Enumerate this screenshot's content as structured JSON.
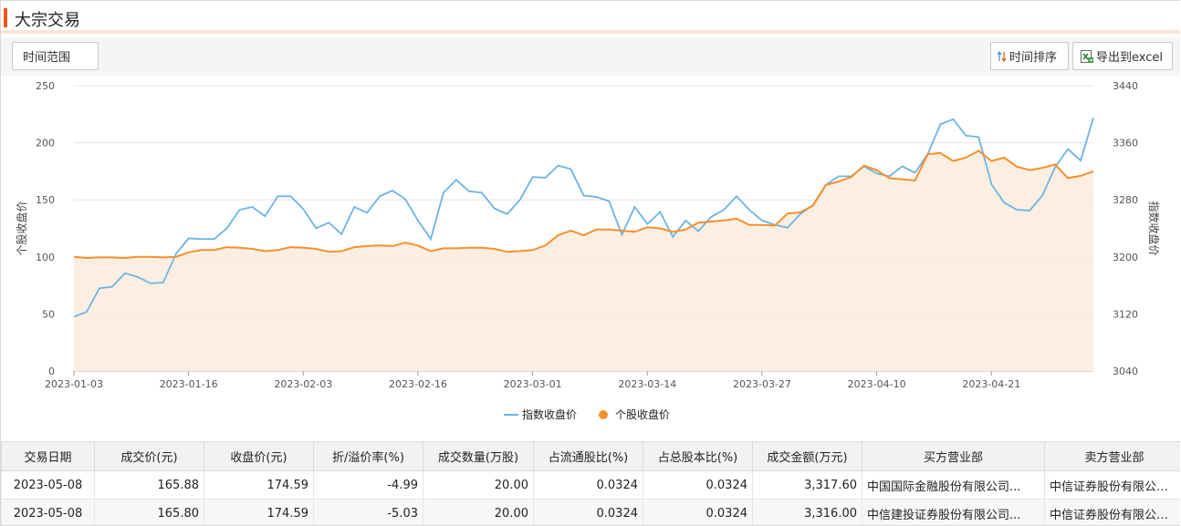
{
  "page": {
    "title": "大宗交易"
  },
  "toolbar": {
    "range_label": "时间范围",
    "sort_label": "时间排序",
    "export_label": "导出到excel"
  },
  "colors": {
    "accent": "#e8591c",
    "index_line": "#6cb4e4",
    "stock_line": "#f7902c",
    "stock_area": "#fdeee2"
  },
  "chart_data": {
    "type": "line",
    "x": [
      "2023-01-03",
      "2023-01-04",
      "2023-01-05",
      "2023-01-06",
      "2023-01-09",
      "2023-01-10",
      "2023-01-11",
      "2023-01-12",
      "2023-01-13",
      "2023-01-16",
      "2023-01-17",
      "2023-01-18",
      "2023-01-19",
      "2023-01-20",
      "2023-01-30",
      "2023-01-31",
      "2023-02-01",
      "2023-02-02",
      "2023-02-03",
      "2023-02-06",
      "2023-02-07",
      "2023-02-08",
      "2023-02-09",
      "2023-02-10",
      "2023-02-13",
      "2023-02-14",
      "2023-02-15",
      "2023-02-16",
      "2023-02-17",
      "2023-02-20",
      "2023-02-21",
      "2023-02-22",
      "2023-02-23",
      "2023-02-24",
      "2023-02-27",
      "2023-02-28",
      "2023-03-01",
      "2023-03-02",
      "2023-03-03",
      "2023-03-06",
      "2023-03-07",
      "2023-03-08",
      "2023-03-09",
      "2023-03-10",
      "2023-03-13",
      "2023-03-14",
      "2023-03-15",
      "2023-03-16",
      "2023-03-17",
      "2023-03-20",
      "2023-03-21",
      "2023-03-22",
      "2023-03-23",
      "2023-03-24",
      "2023-03-27",
      "2023-03-28",
      "2023-03-29",
      "2023-03-30",
      "2023-03-31",
      "2023-04-03",
      "2023-04-04",
      "2023-04-06",
      "2023-04-07",
      "2023-04-10",
      "2023-04-11",
      "2023-04-12",
      "2023-04-13",
      "2023-04-14",
      "2023-04-17",
      "2023-04-18",
      "2023-04-19",
      "2023-04-20",
      "2023-04-21",
      "2023-04-24",
      "2023-04-25",
      "2023-04-26",
      "2023-04-27",
      "2023-04-28",
      "2023-05-04",
      "2023-05-05",
      "2023-05-08"
    ],
    "x_ticks": [
      "2023-01-03",
      "2023-01-16",
      "2023-02-03",
      "2023-02-16",
      "2023-03-01",
      "2023-03-14",
      "2023-03-27",
      "2023-04-10",
      "2023-04-21"
    ],
    "y_left": {
      "label": "个股收盘价",
      "lim": [
        0,
        250
      ],
      "ticks": [
        0,
        50,
        100,
        150,
        200,
        250
      ]
    },
    "y_right": {
      "label": "指数收盘价",
      "lim": [
        3040,
        3440
      ],
      "ticks": [
        3040,
        3120,
        3200,
        3280,
        3360,
        3440
      ]
    },
    "grid": true,
    "legend_position": "bottom",
    "series": [
      {
        "name": "指数收盘价",
        "axis": "right",
        "values": [
          3116,
          3123,
          3156,
          3158,
          3177,
          3172,
          3163,
          3164,
          3204,
          3226,
          3225,
          3225,
          3240,
          3266,
          3270,
          3257,
          3285,
          3285,
          3267,
          3240,
          3248,
          3232,
          3270,
          3262,
          3285,
          3293,
          3281,
          3251,
          3225,
          3290,
          3308,
          3292,
          3290,
          3268,
          3260,
          3280,
          3312,
          3311,
          3328,
          3323,
          3286,
          3284,
          3278,
          3231,
          3270,
          3246,
          3263,
          3228,
          3251,
          3236,
          3256,
          3266,
          3285,
          3266,
          3251,
          3245,
          3241,
          3260,
          3273,
          3301,
          3313,
          3313,
          3327,
          3317,
          3313,
          3327,
          3318,
          3344,
          3386,
          3393,
          3370,
          3368,
          3302,
          3276,
          3266,
          3265,
          3286,
          3326,
          3351,
          3335,
          3395
        ]
      },
      {
        "name": "个股收盘价",
        "axis": "left",
        "values": [
          100,
          99,
          99.5,
          99.5,
          99,
          100,
          100,
          99.5,
          100,
          104,
          106,
          106,
          108.5,
          108,
          107,
          105,
          106,
          108.5,
          108,
          107,
          104.5,
          105,
          108.5,
          109.5,
          110,
          109.5,
          112.5,
          110,
          105,
          107.5,
          107.5,
          108,
          108,
          107,
          104.5,
          105,
          106,
          110,
          119,
          123,
          119,
          124,
          124,
          123,
          122,
          126,
          125,
          122,
          124,
          130,
          131,
          132,
          133.5,
          128,
          128,
          127.5,
          138,
          139,
          145,
          163,
          166,
          170,
          180,
          176,
          169,
          168,
          167,
          190,
          191,
          184,
          187,
          193,
          184,
          187,
          179,
          176,
          178,
          181,
          169,
          171,
          175
        ]
      }
    ]
  },
  "table": {
    "headers": [
      "交易日期",
      "成交价(元)",
      "收盘价(元)",
      "折/溢价率(%)",
      "成交数量(万股)",
      "占流通股比(%)",
      "占总股本比(%)",
      "成交金额(万元)",
      "买方营业部",
      "卖方营业部"
    ],
    "rows": [
      [
        "2023-05-08",
        "165.88",
        "174.59",
        "-4.99",
        "20.00",
        "0.0324",
        "0.0324",
        "3,317.60",
        "中国国际金融股份有限公司...",
        "中信证券股份有限公司..."
      ],
      [
        "2023-05-08",
        "165.80",
        "174.59",
        "-5.03",
        "20.00",
        "0.0324",
        "0.0324",
        "3,316.00",
        "中信建投证券股份有限公司...",
        "中信证券股份有限公司..."
      ]
    ]
  }
}
